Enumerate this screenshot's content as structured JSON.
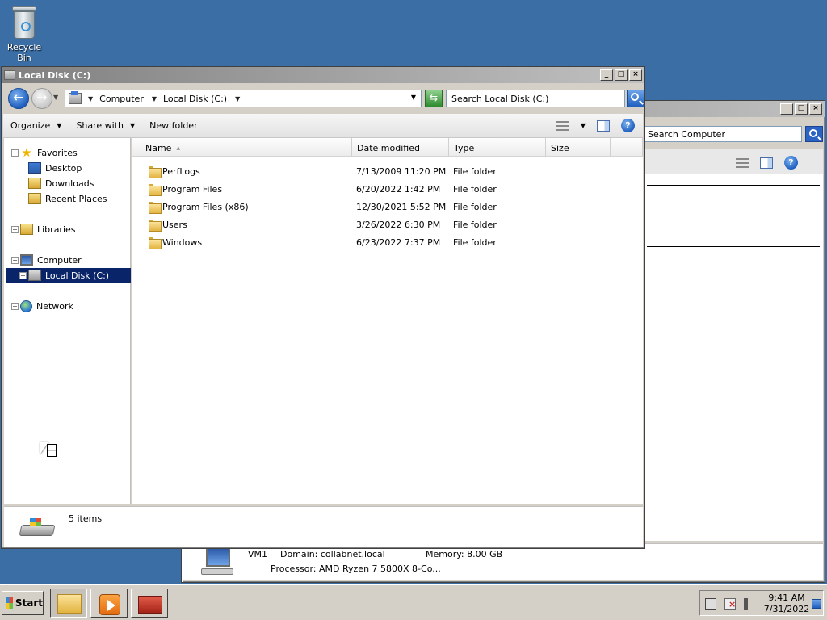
{
  "desktop": {
    "recycle_bin_label": "Recycle Bin"
  },
  "back_window": {
    "search_placeholder": "Search Computer",
    "details": {
      "name": "VM1",
      "domain": "Domain: collabnet.local",
      "memory": "Memory: 8.00 GB",
      "processor": "Processor: AMD Ryzen 7 5800X 8-Co..."
    }
  },
  "main_window": {
    "title": "Local Disk (C:)",
    "controls": {
      "minimize": "_",
      "maximize": "□",
      "close": "×"
    },
    "address": {
      "crumbs": [
        "Computer",
        "Local Disk (C:)"
      ]
    },
    "search_placeholder": "Search Local Disk (C:)",
    "commands": {
      "organize": "Organize",
      "share_with": "Share with",
      "new_folder": "New folder"
    },
    "nav_tree": {
      "favorites": "Favorites",
      "desktop": "Desktop",
      "downloads": "Downloads",
      "recent": "Recent Places",
      "libraries": "Libraries",
      "computer": "Computer",
      "local_disk": "Local Disk (C:)",
      "network": "Network"
    },
    "columns": {
      "name": "Name",
      "date": "Date modified",
      "type": "Type",
      "size": "Size"
    },
    "files": [
      {
        "name": "PerfLogs",
        "date": "7/13/2009 11:20 PM",
        "type": "File folder"
      },
      {
        "name": "Program Files",
        "date": "6/20/2022 1:42 PM",
        "type": "File folder"
      },
      {
        "name": "Program Files (x86)",
        "date": "12/30/2021 5:52 PM",
        "type": "File folder"
      },
      {
        "name": "Users",
        "date": "3/26/2022 6:30 PM",
        "type": "File folder"
      },
      {
        "name": "Windows",
        "date": "6/23/2022 7:37 PM",
        "type": "File folder"
      }
    ],
    "status": "5 items"
  },
  "taskbar": {
    "start_label": "Start",
    "clock_time": "9:41 AM",
    "clock_date": "7/31/2022"
  },
  "colors": {
    "desktop": "#3a6ea5",
    "selection": "#0a246a",
    "chrome": "#d4d0c8"
  }
}
